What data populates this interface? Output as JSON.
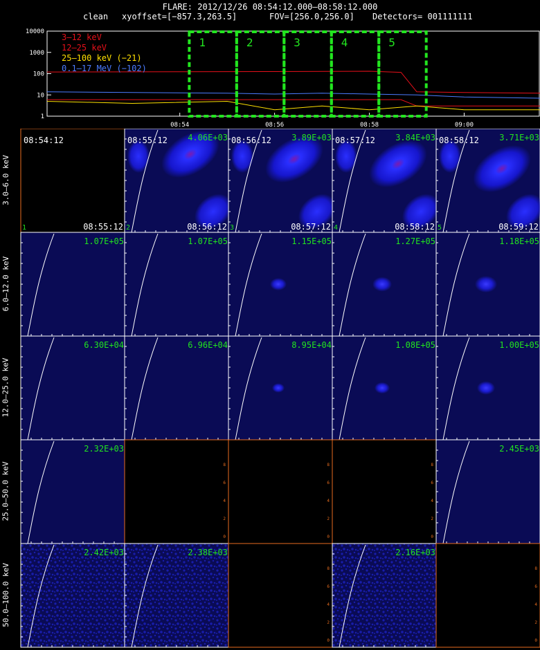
{
  "header": {
    "title": "FLARE: 2012/12/26 08:54:12.000—08:58:12.000",
    "mode": "clean",
    "xyoffset": "xyoffset=[−857.3,263.5]",
    "fov": "FOV=[256.0,256.0]",
    "detectors": "Detectors= 001111111"
  },
  "chart_data": [
    {
      "type": "line",
      "title": "",
      "yscale": "log",
      "ylim": [
        1,
        10000
      ],
      "yticks": [
        "1",
        "10",
        "100",
        "1000",
        "10000"
      ],
      "xticks": [
        "08:54",
        "08:56",
        "08:58",
        "09:00"
      ],
      "xlim": [
        "08:51:12",
        "09:01:36"
      ],
      "series": [
        {
          "name": "3—12 keV",
          "color": "#e8101a",
          "times": [
            "08:51:12",
            "08:54:00",
            "08:56:00",
            "08:58:00",
            "08:58:40",
            "08:59:00",
            "09:00:00",
            "09:01:36"
          ],
          "values": [
            120,
            122,
            125,
            130,
            115,
            14,
            13,
            12
          ]
        },
        {
          "name": "12—25 keV",
          "color": "#e8101a",
          "times": [
            "08:51:12",
            "08:58:40",
            "08:59:00",
            "09:01:36"
          ],
          "values": [
            6,
            6,
            3,
            3
          ]
        },
        {
          "name": "25—100 keV (−21)",
          "color": "#ffe000",
          "times": [
            "08:51:12",
            "08:53:00",
            "08:55:00",
            "08:56:00",
            "08:57:00",
            "08:58:00",
            "08:59:00",
            "09:00:00",
            "09:01:36"
          ],
          "values": [
            5,
            4,
            5,
            2,
            3,
            2,
            3,
            2,
            2
          ]
        },
        {
          "name": "0.1—17 MeV (−102)",
          "color": "#4b7cff",
          "times": [
            "08:51:12",
            "08:53:00",
            "08:55:00",
            "08:56:00",
            "08:57:00",
            "08:58:00",
            "08:59:00",
            "09:00:00",
            "09:01:36"
          ],
          "values": [
            14,
            13,
            12,
            11,
            12,
            11,
            10,
            8,
            7
          ]
        }
      ],
      "intervals": [
        {
          "label": "1",
          "start": "08:54:12",
          "end": "08:55:12"
        },
        {
          "label": "2",
          "start": "08:55:12",
          "end": "08:56:12"
        },
        {
          "label": "3",
          "start": "08:56:12",
          "end": "08:57:12"
        },
        {
          "label": "4",
          "start": "08:57:12",
          "end": "08:58:12"
        },
        {
          "label": "5",
          "start": "08:58:12",
          "end": "08:59:12"
        }
      ],
      "interval_color": "#22e51f"
    },
    {
      "type": "heatmap",
      "energy_bands": [
        "3.0—6.0 keV",
        "6.0—12.0 keV",
        "12.0—25.0 keV",
        "25.0—50.0 keV",
        "50.0—100.0 keV"
      ],
      "intervals": [
        {
          "label": "1",
          "start": "08:54:12",
          "end": "08:55:12"
        },
        {
          "label": "2",
          "start": "08:55:12",
          "end": "08:56:12"
        },
        {
          "label": "3",
          "start": "08:56:12",
          "end": "08:57:12"
        },
        {
          "label": "4",
          "start": "08:57:12",
          "end": "08:58:12"
        },
        {
          "label": "5",
          "start": "08:58:12",
          "end": "08:59:12"
        }
      ],
      "peak_values": [
        [
          null,
          "4.06E+03",
          "3.89E+03",
          "3.84E+03",
          "3.71E+03"
        ],
        [
          "1.07E+05",
          "1.07E+05",
          "1.15E+05",
          "1.27E+05",
          "1.18E+05"
        ],
        [
          "6.30E+04",
          "6.96E+04",
          "8.95E+04",
          "1.08E+05",
          "1.00E+05"
        ],
        [
          "2.32E+03",
          null,
          null,
          null,
          "2.45E+03"
        ],
        [
          "2.42E+03",
          "2.38E+03",
          null,
          "2.16E+03",
          null
        ]
      ],
      "empty_axis_ticks": [
        "0",
        "2",
        "4",
        "6",
        "8"
      ]
    }
  ]
}
